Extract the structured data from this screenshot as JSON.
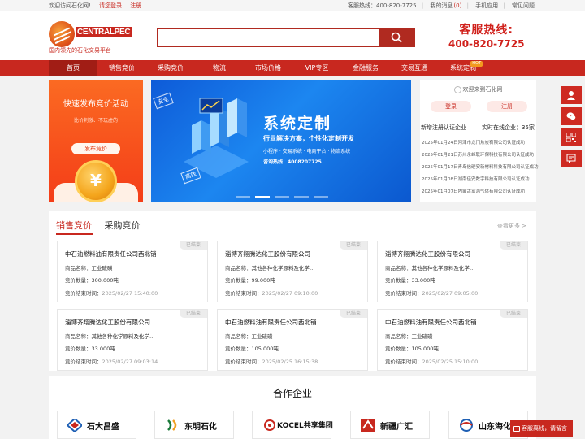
{
  "topbar": {
    "welcome": "欢迎访问石化网!",
    "login": "请您登录",
    "register": "注册",
    "hotline_label": "客服热线：",
    "hotline_number": "400-820-7725",
    "my_messages": "我的消息",
    "message_count": "(0)",
    "mobile_app": "手机应用",
    "faq": "常见问题"
  },
  "logo": {
    "brand": "CENTRALPEC",
    "slogan": "国内领先的石化交易平台"
  },
  "search": {
    "placeholder": "",
    "value": ""
  },
  "hotline": {
    "label": "客服热线:",
    "number": "400-820-7725"
  },
  "nav": {
    "items": [
      {
        "label": "首页"
      },
      {
        "label": "销售竞价"
      },
      {
        "label": "采购竞价"
      },
      {
        "label": "物流"
      },
      {
        "label": "市场价格"
      },
      {
        "label": "VIP专区"
      },
      {
        "label": "金融服务"
      },
      {
        "label": "交易互通"
      },
      {
        "label": "系统定制"
      }
    ],
    "hot_badge": "HOT"
  },
  "promo": {
    "title": "快速发布竞价活动",
    "subtitle": "比价刺激、不玩虚的",
    "button": "发布竞价",
    "coin_symbol": "¥"
  },
  "banner": {
    "title": "系统定制",
    "subtitle": "行业解决方案，个性化定制开发",
    "services": "小程序 · 交易系统 · 电商平台 · 物流系统",
    "consult": "咨询热线：4008207725",
    "tag_safe": "安全",
    "tag_efficient": "高效"
  },
  "login_card": {
    "welcome": "欢迎来到石化网",
    "login_button": "登录",
    "register_button": "注册",
    "stat_a": "新增注册认证企业",
    "stat_b": "实时在线企业：35家",
    "news": [
      "2025年01月24日河津市龙门焦炭有限公司认证成功",
      "2025年01月21日苏州永峰联环保科技有限公司认证成功",
      "2025年01月17日青岛信硬安新材料科技有限公司认证成功",
      "2025年01月08日湖南佳安数字科技有限公司认证成功",
      "2025年01月07日内蒙古富浩气体有限公司认证成功"
    ]
  },
  "bidding": {
    "tab_sales": "销售竞价",
    "tab_purchase": "采购竞价",
    "more": "查看更多 >",
    "label_product": "商品名称：",
    "label_qty": "竞价数量：",
    "label_end": "竞价结束时间：",
    "cards": [
      {
        "company": "中石油燃料油有限责任公司西北销",
        "status": "已结束",
        "product": "工业硫磺",
        "qty": "300.000吨",
        "end": "2025/02/27 15:40:00"
      },
      {
        "company": "淄博齐翔腾达化工股份有限公司",
        "status": "已结束",
        "product": "其他各种化学原料及化学…",
        "qty": "99.000吨",
        "end": "2025/02/27 09:10:00"
      },
      {
        "company": "淄博齐翔腾达化工股份有限公司",
        "status": "已结束",
        "product": "其他各种化学原料及化学…",
        "qty": "33.000吨",
        "end": "2025/02/27 09:05:00"
      },
      {
        "company": "淄博齐翔腾达化工股份有限公司",
        "status": "已结束",
        "product": "其他各种化学原料及化学…",
        "qty": "33.000吨",
        "end": "2025/02/27 09:03:14"
      },
      {
        "company": "中石油燃料油有限责任公司西北销",
        "status": "已结束",
        "product": "工业硫磺",
        "qty": "105.000吨",
        "end": "2025/02/25 16:15:38"
      },
      {
        "company": "中石油燃料油有限责任公司西北销",
        "status": "已结束",
        "product": "工业硫磺",
        "qty": "105.000吨",
        "end": "2025/02/25 15:10:00"
      }
    ]
  },
  "partners": {
    "title": "合作企业",
    "items": [
      {
        "name": "石大昌盛",
        "color": "#1e5fb4"
      },
      {
        "name": "东明石化",
        "color": "#1b7a3a"
      },
      {
        "name": "KOCEL共享集团",
        "color": "#c8281f"
      },
      {
        "name": "新疆广汇",
        "color": "#c8281f"
      },
      {
        "name": "山东海化",
        "color": "#1e5fb4"
      }
    ]
  },
  "float_message": "客服离线，请留言",
  "colors": {
    "brand_red": "#c8281f",
    "nav_active": "#a11d15",
    "promo_orange": "#f43d18",
    "banner_blue": "#1c86f0"
  },
  "icons": {
    "search": "search-icon",
    "side": [
      "customer-service-icon",
      "wechat-icon",
      "qrcode-icon",
      "feedback-icon"
    ]
  }
}
